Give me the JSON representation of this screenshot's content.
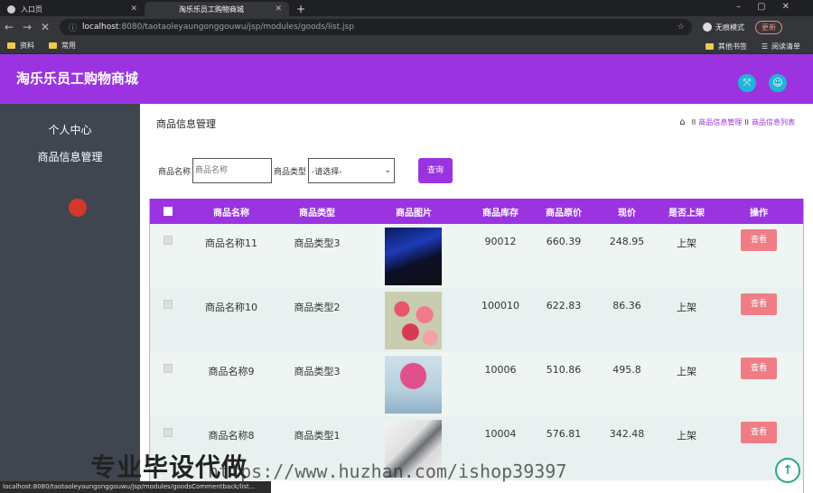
{
  "browser": {
    "tabs": [
      {
        "label": "入口页"
      },
      {
        "label": "淘乐乐员工购物商城"
      }
    ],
    "url_host": "localhost",
    "url_path": ":8080/taotaoleyaungonggouwu/jsp/modules/goods/list.jsp",
    "incognito_label": "无痕模式",
    "update_label": "更新",
    "bookmarks": [
      "资料",
      "常用"
    ],
    "bookmarks_right": [
      "其他书签",
      "阅读清单"
    ],
    "status_url": "localhost:8080/taotaoleyaungonggouwu/jsp/modules/goodsCommentback/list..."
  },
  "header": {
    "title": "淘乐乐员工购物商城"
  },
  "sidebar": {
    "items": [
      {
        "label": "个人中心"
      },
      {
        "label": "商品信息管理"
      }
    ]
  },
  "main": {
    "page_title": "商品信息管理",
    "breadcrumb": [
      "商品信息管理",
      "商品信息列表"
    ],
    "search": {
      "name_label": "商品名称",
      "name_placeholder": "商品名称",
      "type_label": "商品类型",
      "type_selected": "-请选择-",
      "query_label": "查询"
    },
    "table": {
      "headers": [
        "商品名称",
        "商品类型",
        "商品图片",
        "商品库存",
        "商品原价",
        "现价",
        "是否上架",
        "操作"
      ],
      "view_label": "查看",
      "rows": [
        {
          "name": "商品名称11",
          "type": "商品类型3",
          "stock": "90012",
          "orig": "660.39",
          "price": "248.95",
          "status": "上架"
        },
        {
          "name": "商品名称10",
          "type": "商品类型2",
          "stock": "100010",
          "orig": "622.83",
          "price": "86.36",
          "status": "上架"
        },
        {
          "name": "商品名称9",
          "type": "商品类型3",
          "stock": "10006",
          "orig": "510.86",
          "price": "495.8",
          "status": "上架"
        },
        {
          "name": "商品名称8",
          "type": "商品类型1",
          "stock": "10004",
          "orig": "576.81",
          "price": "342.48",
          "status": "上架"
        }
      ]
    }
  },
  "overlay": {
    "watermark_cn": "专业毕设代做",
    "watermark_url": "https://www.huzhan.com/ishop39397"
  }
}
